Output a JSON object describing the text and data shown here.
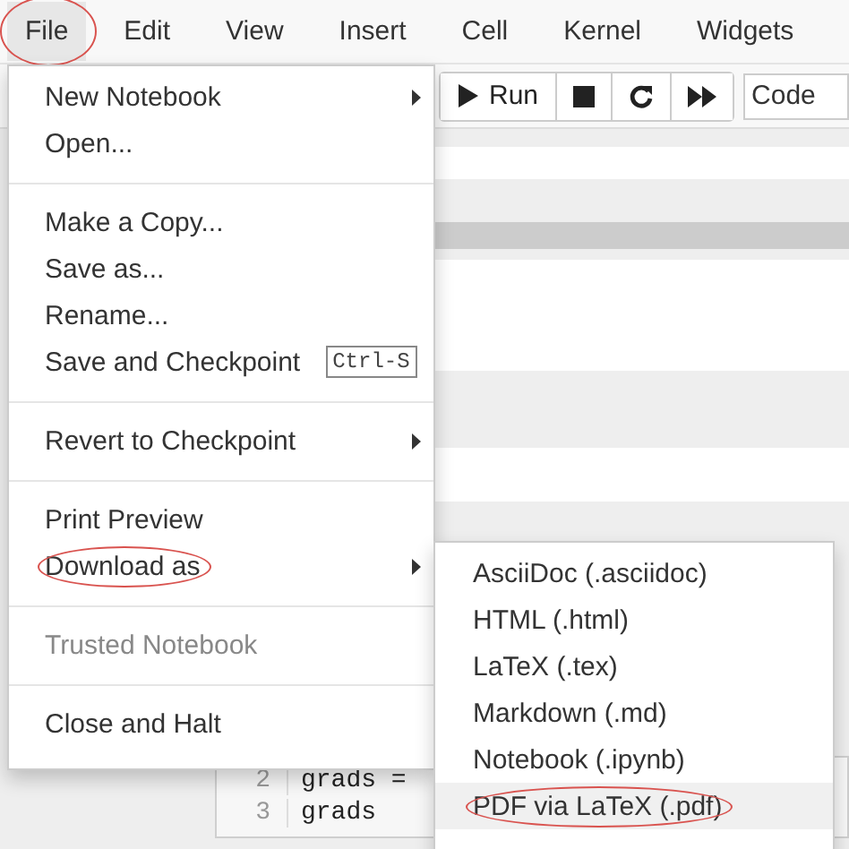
{
  "menubar": [
    {
      "label": "File",
      "selected": true,
      "circled": true
    },
    {
      "label": "Edit",
      "selected": false,
      "circled": false
    },
    {
      "label": "View",
      "selected": false,
      "circled": false
    },
    {
      "label": "Insert",
      "selected": false,
      "circled": false
    },
    {
      "label": "Cell",
      "selected": false,
      "circled": false
    },
    {
      "label": "Kernel",
      "selected": false,
      "circled": false
    },
    {
      "label": "Widgets",
      "selected": false,
      "circled": false
    }
  ],
  "toolbar": {
    "buttons": [
      {
        "kind": "run",
        "label": "Run"
      },
      {
        "kind": "stop"
      },
      {
        "kind": "restart"
      },
      {
        "kind": "fast-forward"
      }
    ],
    "cell_type": "Code"
  },
  "code_cell": {
    "lines": [
      {
        "number": "2",
        "code": "grads ="
      },
      {
        "number": "3",
        "code": "grads"
      }
    ]
  },
  "file_menu": [
    {
      "kind": "item",
      "label": "New Notebook",
      "submenu": true,
      "disabled": false,
      "circled": false
    },
    {
      "kind": "item",
      "label": "Open...",
      "submenu": false,
      "disabled": false,
      "circled": false
    },
    {
      "kind": "separator"
    },
    {
      "kind": "item",
      "label": "Make a Copy...",
      "submenu": false,
      "disabled": false,
      "circled": false
    },
    {
      "kind": "item",
      "label": "Save as...",
      "submenu": false,
      "disabled": false,
      "circled": false
    },
    {
      "kind": "item",
      "label": "Rename...",
      "submenu": false,
      "disabled": false,
      "circled": false
    },
    {
      "kind": "item",
      "label": "Save and Checkpoint",
      "shortcut": "Ctrl-S",
      "submenu": false,
      "disabled": false,
      "circled": false
    },
    {
      "kind": "separator"
    },
    {
      "kind": "item",
      "label": "Revert to Checkpoint",
      "submenu": true,
      "disabled": false,
      "circled": false
    },
    {
      "kind": "separator"
    },
    {
      "kind": "item",
      "label": "Print Preview",
      "submenu": false,
      "disabled": false,
      "circled": false
    },
    {
      "kind": "item",
      "label": "Download as",
      "submenu": true,
      "disabled": false,
      "circled": true
    },
    {
      "kind": "separator"
    },
    {
      "kind": "item",
      "label": "Trusted Notebook",
      "submenu": false,
      "disabled": true,
      "circled": false
    },
    {
      "kind": "separator"
    },
    {
      "kind": "item",
      "label": "Close and Halt",
      "submenu": false,
      "disabled": false,
      "circled": false
    }
  ],
  "download_submenu": [
    {
      "label": "AsciiDoc (.asciidoc)",
      "selected": false,
      "circled": false
    },
    {
      "label": "HTML (.html)",
      "selected": false,
      "circled": false
    },
    {
      "label": "LaTeX (.tex)",
      "selected": false,
      "circled": false
    },
    {
      "label": "Markdown (.md)",
      "selected": false,
      "circled": false
    },
    {
      "label": "Notebook (.ipynb)",
      "selected": false,
      "circled": false
    },
    {
      "label": "PDF via LaTeX (.pdf)",
      "selected": true,
      "circled": true
    }
  ]
}
